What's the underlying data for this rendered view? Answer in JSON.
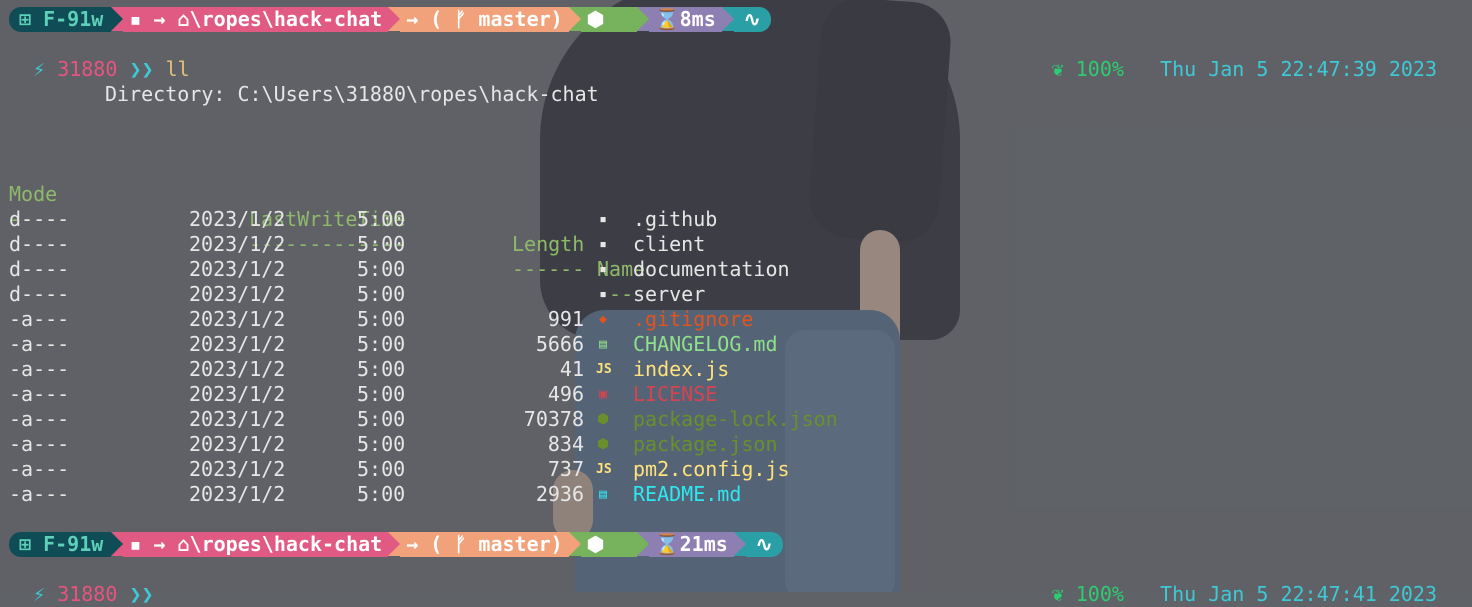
{
  "prompt1": {
    "host_icon": "windows-icon",
    "host": "F-91w",
    "path_icon": "folder-icon",
    "path_arrow": "→",
    "home_icon": "home-icon",
    "path": "\\ropes\\hack-chat",
    "git": "→ ( ᚠ master)",
    "node_icon": "nodejs-icon",
    "exec_icon": "hourglass-icon",
    "exec_time": "8ms",
    "status_icon": "pulse-icon",
    "bolt": "⚡",
    "number": "31880",
    "chevrons": "❯❯",
    "command": "ll",
    "battery_icon": "sprout-icon",
    "battery": "100%",
    "datetime": "Thu Jan 5 22:47:39 2023"
  },
  "listing": {
    "directory_label": "Directory: C:\\Users\\31880\\ropes\\hack-chat",
    "headers": {
      "mode": "Mode",
      "lastwrite": "LastWriteTime",
      "length": "Length",
      "name": "Name"
    },
    "underlines": {
      "mode": "----",
      "lastwrite": "-------------",
      "length": "------",
      "name": "----"
    },
    "rows": [
      {
        "mode": "d----",
        "date": "2023/1/2",
        "time": "5:00",
        "length": "",
        "icon": "github-folder-icon",
        "glyph": "▪",
        "name": ".github",
        "kind": "dir"
      },
      {
        "mode": "d----",
        "date": "2023/1/2",
        "time": "5:00",
        "length": "",
        "icon": "folder-icon",
        "glyph": "▪",
        "name": "client",
        "kind": "dir"
      },
      {
        "mode": "d----",
        "date": "2023/1/2",
        "time": "5:00",
        "length": "",
        "icon": "folder-icon",
        "glyph": "▪",
        "name": "documentation",
        "kind": "dir"
      },
      {
        "mode": "d----",
        "date": "2023/1/2",
        "time": "5:00",
        "length": "",
        "icon": "folder-icon",
        "glyph": "▪",
        "name": "server",
        "kind": "dir"
      },
      {
        "mode": "-a---",
        "date": "2023/1/2",
        "time": "5:00",
        "length": "991",
        "icon": "git-icon",
        "glyph": "◆",
        "name": ".gitignore",
        "kind": "git"
      },
      {
        "mode": "-a---",
        "date": "2023/1/2",
        "time": "5:00",
        "length": "5666",
        "icon": "changelog-icon",
        "glyph": "▤",
        "name": "CHANGELOG.md",
        "kind": "md"
      },
      {
        "mode": "-a---",
        "date": "2023/1/2",
        "time": "5:00",
        "length": "41",
        "icon": "javascript-icon",
        "glyph": "JS",
        "name": "index.js",
        "kind": "js"
      },
      {
        "mode": "-a---",
        "date": "2023/1/2",
        "time": "5:00",
        "length": "496",
        "icon": "license-icon",
        "glyph": "▣",
        "name": "LICENSE",
        "kind": "lic"
      },
      {
        "mode": "-a---",
        "date": "2023/1/2",
        "time": "5:00",
        "length": "70378",
        "icon": "nodejs-icon",
        "glyph": "⬢",
        "name": "package-lock.json",
        "kind": "json"
      },
      {
        "mode": "-a---",
        "date": "2023/1/2",
        "time": "5:00",
        "length": "834",
        "icon": "nodejs-icon",
        "glyph": "⬢",
        "name": "package.json",
        "kind": "json"
      },
      {
        "mode": "-a---",
        "date": "2023/1/2",
        "time": "5:00",
        "length": "737",
        "icon": "javascript-icon",
        "glyph": "JS",
        "name": "pm2.config.js",
        "kind": "js"
      },
      {
        "mode": "-a---",
        "date": "2023/1/2",
        "time": "5:00",
        "length": "2936",
        "icon": "readme-icon",
        "glyph": "▤",
        "name": "README.md",
        "kind": "readme"
      }
    ]
  },
  "prompt2": {
    "host": "F-91w",
    "path_arrow": "→",
    "path": "\\ropes\\hack-chat",
    "git": "→ ( ᚠ master)",
    "exec_time": "21ms",
    "bolt": "⚡",
    "number": "31880",
    "chevrons": "❯❯",
    "battery": "100%",
    "datetime": "Thu Jan 5 22:47:41 2023"
  },
  "colors": {
    "seg_host": "#0f4c55",
    "seg_path": "#e05a84",
    "seg_git": "#f2a27a",
    "seg_node": "#76b35c",
    "seg_time": "#8e7fb3",
    "seg_status": "#2a9fa6"
  }
}
